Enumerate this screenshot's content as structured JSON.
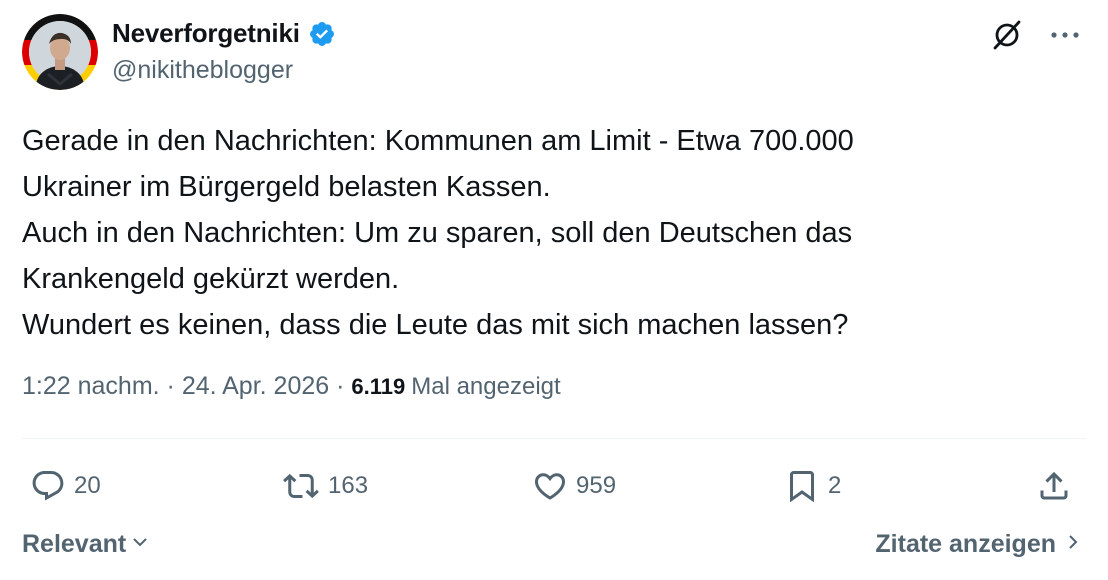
{
  "user": {
    "display_name": "Neverforgetniki",
    "handle": "@nikitheblogger",
    "verified": true
  },
  "tweet": {
    "lines": [
      "Gerade in den Nachrichten: Kommunen am Limit - Etwa 700.000",
      "Ukrainer im Bürgergeld belasten Kassen.",
      "Auch in den Nachrichten: Um zu sparen, soll den Deutschen das",
      "Krankengeld gekürzt werden.",
      "Wundert es keinen, dass die Leute das mit sich machen lassen?"
    ]
  },
  "meta": {
    "time": "1:22 nachm.",
    "separator1": " · ",
    "date": "24. Apr. 2026",
    "separator2": " · ",
    "views_count": "6.119",
    "views_label": "Mal angezeigt"
  },
  "actions": {
    "replies": "20",
    "reposts": "163",
    "likes": "959",
    "bookmarks": "2"
  },
  "footer": {
    "sort_label": "Relevant",
    "quotes_label": "Zitate anzeigen"
  },
  "colors": {
    "text": "#0f1419",
    "secondary": "#536471",
    "verified": "#1d9bf0",
    "divider": "#eff3f4"
  },
  "icons": [
    "verified-badge-icon",
    "grok-icon",
    "more-icon",
    "reply-icon",
    "repost-icon",
    "like-icon",
    "bookmark-icon",
    "share-icon",
    "chevron-down-icon",
    "chevron-right-icon"
  ]
}
